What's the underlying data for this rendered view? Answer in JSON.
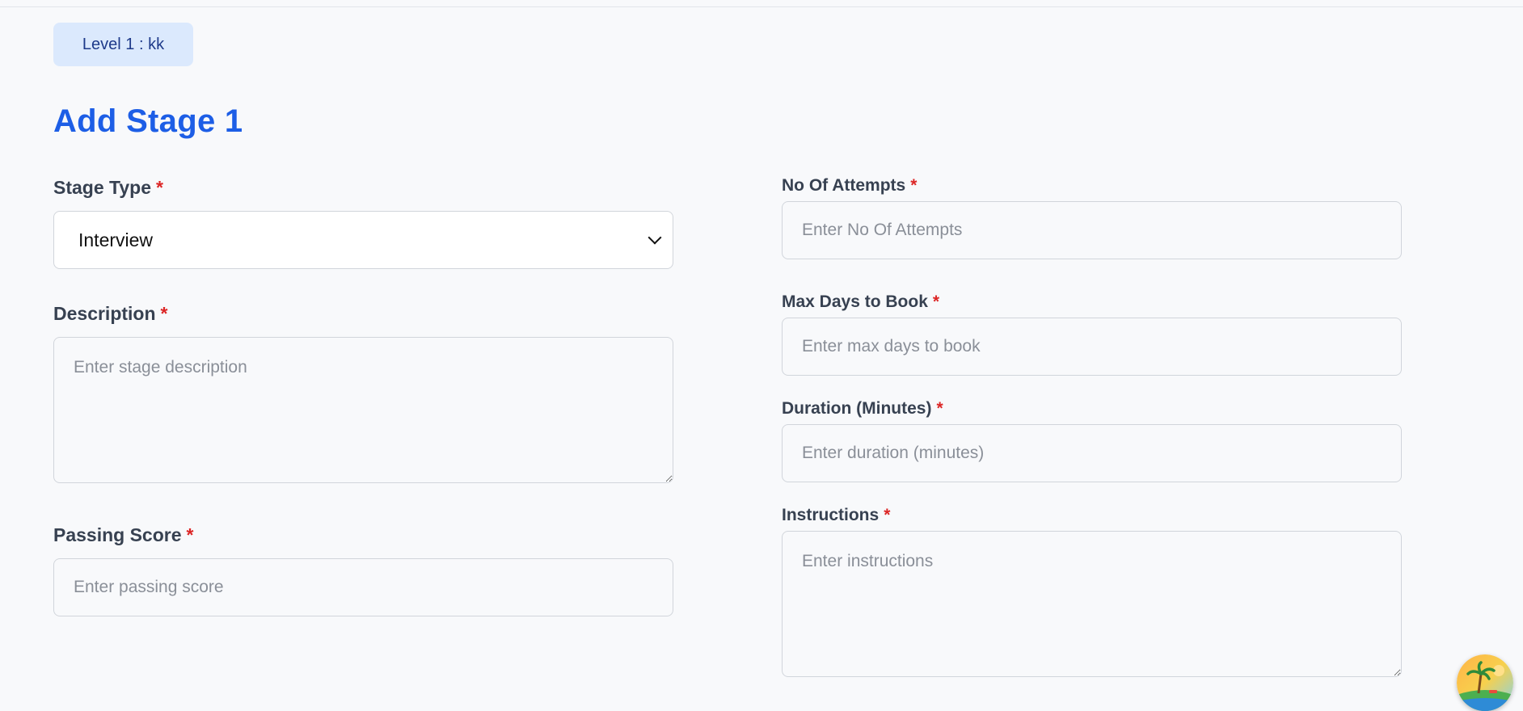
{
  "level_badge": {
    "label": "Level 1 : kk"
  },
  "page_title": "Add Stage 1",
  "required_marker": "*",
  "left_column": {
    "stage_type": {
      "label": "Stage Type",
      "selected_value": "Interview"
    },
    "description": {
      "label": "Description",
      "placeholder": "Enter stage description",
      "value": ""
    },
    "passing_score": {
      "label": "Passing Score",
      "placeholder": "Enter passing score",
      "value": ""
    }
  },
  "right_column": {
    "no_of_attempts": {
      "label": "No Of Attempts",
      "placeholder": "Enter No Of Attempts",
      "value": ""
    },
    "max_days_to_book": {
      "label": "Max Days to Book",
      "placeholder": "Enter max days to book",
      "value": ""
    },
    "duration_minutes": {
      "label": "Duration (Minutes)",
      "placeholder": "Enter duration (minutes)",
      "value": ""
    },
    "instructions": {
      "label": "Instructions",
      "placeholder": "Enter instructions",
      "value": ""
    }
  },
  "floating_button": {
    "icon": "beach-avatar-icon"
  },
  "colors": {
    "title": "#1d5ee6",
    "badge_bg": "#dbe9fd",
    "required": "#dc2626",
    "page_bg": "#f8f9fb"
  }
}
